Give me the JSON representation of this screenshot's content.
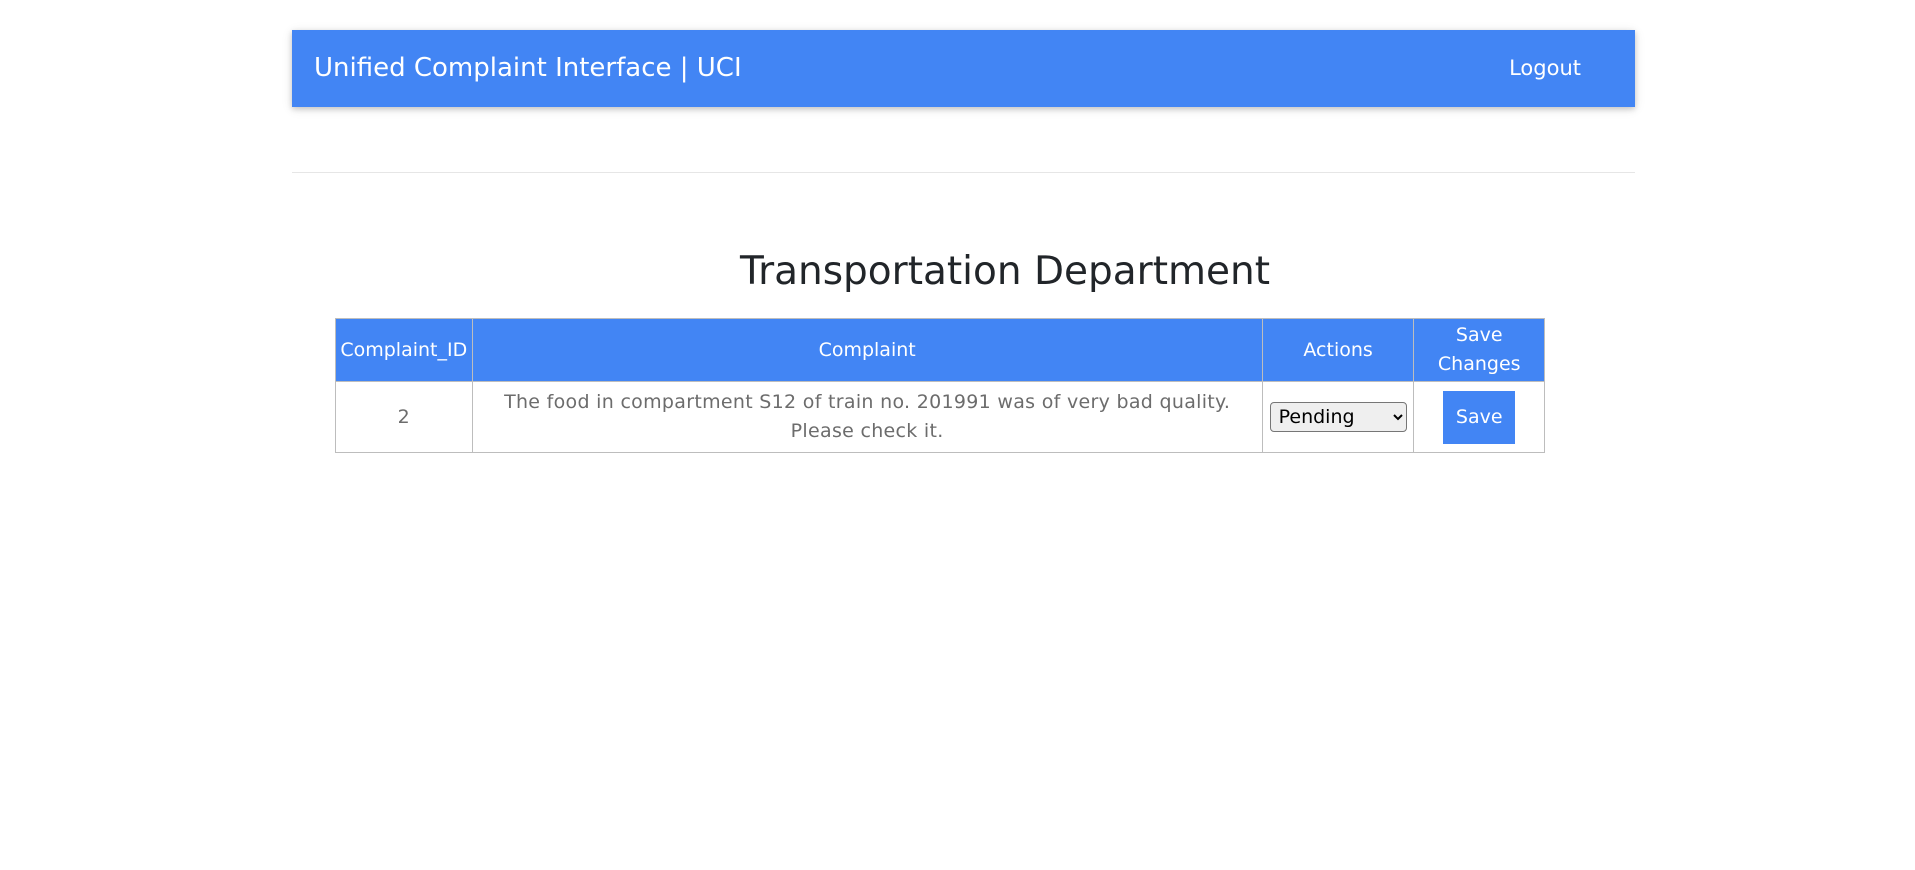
{
  "navbar": {
    "brand": "Unified Complaint Interface | UCI",
    "logout_label": "Logout",
    "background": "#4285f4"
  },
  "main": {
    "title": "Transportation Department",
    "table": {
      "headers": {
        "id": "Complaint_ID",
        "complaint": "Complaint",
        "actions": "Actions",
        "save": "Save Changes"
      },
      "rows": [
        {
          "id": "2",
          "complaint": "The food in compartment S12 of train no. 201991 was of very bad quality. Please check it.",
          "status": "Pending",
          "save_label": "Save"
        }
      ]
    }
  }
}
